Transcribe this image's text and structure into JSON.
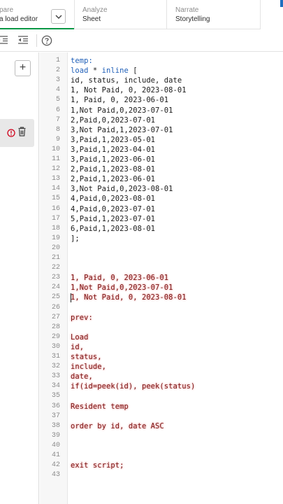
{
  "tabs": {
    "prepare": {
      "caption": "pare",
      "title": "a load editor"
    },
    "analyze": {
      "caption": "Analyze",
      "title": "Sheet"
    },
    "narrate": {
      "caption": "Narrate",
      "title": "Storytelling"
    }
  },
  "toolbar": {
    "icons": [
      "indent-icon",
      "outdent-icon",
      "help-icon"
    ]
  },
  "left_panel": {
    "add_label": "+"
  },
  "editor": {
    "line_numbers": [
      "1",
      "2",
      "3",
      "4",
      "5",
      "6",
      "7",
      "8",
      "9",
      "10",
      "11",
      "12",
      "13",
      "14",
      "15",
      "16",
      "17",
      "18",
      "19",
      "20",
      "21",
      "22",
      "23",
      "24",
      "25",
      "26",
      "27",
      "28",
      "29",
      "30",
      "31",
      "32",
      "33",
      "34",
      "35",
      "36",
      "37",
      "38",
      "39",
      "40",
      "41",
      "42",
      "43"
    ],
    "lines": [
      {
        "n": 1,
        "text": "temp:",
        "style": "kw"
      },
      {
        "n": 2,
        "text": "load * inline [",
        "style": "kw"
      },
      {
        "n": 3,
        "text": "id, status, include, date",
        "style": "plain"
      },
      {
        "n": 4,
        "text": "1, Not Paid, 0, 2023-08-01",
        "style": "plain"
      },
      {
        "n": 5,
        "text": "1, Paid, 0, 2023-06-01",
        "style": "plain"
      },
      {
        "n": 6,
        "text": "1,Not Paid,0,2023-07-01",
        "style": "plain"
      },
      {
        "n": 7,
        "text": "2,Paid,0,2023-07-01",
        "style": "plain"
      },
      {
        "n": 8,
        "text": "3,Not Paid,1,2023-07-01",
        "style": "plain"
      },
      {
        "n": 9,
        "text": "3,Paid,1,2023-05-01",
        "style": "plain"
      },
      {
        "n": 10,
        "text": "3,Paid,1,2023-04-01",
        "style": "plain"
      },
      {
        "n": 11,
        "text": "3,Paid,1,2023-06-01",
        "style": "plain"
      },
      {
        "n": 12,
        "text": "2,Paid,1,2023-08-01",
        "style": "plain"
      },
      {
        "n": 13,
        "text": "2,Paid,1,2023-06-01",
        "style": "plain"
      },
      {
        "n": 14,
        "text": "3,Not Paid,0,2023-08-01",
        "style": "plain"
      },
      {
        "n": 15,
        "text": "4,Paid,0,2023-08-01",
        "style": "plain"
      },
      {
        "n": 16,
        "text": "4,Paid,0,2023-07-01",
        "style": "plain"
      },
      {
        "n": 17,
        "text": "5,Paid,1,2023-07-01",
        "style": "plain"
      },
      {
        "n": 18,
        "text": "6,Paid,1,2023-08-01",
        "style": "plain"
      },
      {
        "n": 19,
        "text": "];",
        "style": "plain"
      },
      {
        "n": 20,
        "text": "",
        "style": "plain"
      },
      {
        "n": 21,
        "text": "",
        "style": "plain"
      },
      {
        "n": 22,
        "text": "",
        "style": "plain"
      },
      {
        "n": 23,
        "text": "1, Paid, 0, 2023-06-01",
        "style": "red"
      },
      {
        "n": 24,
        "text": "1,Not Paid,0,2023-07-01",
        "style": "red"
      },
      {
        "n": 25,
        "text": "1, Not Paid, 0, 2023-08-01",
        "style": "red"
      },
      {
        "n": 26,
        "text": "",
        "style": "plain"
      },
      {
        "n": 27,
        "text": "prev:",
        "style": "red"
      },
      {
        "n": 28,
        "text": "",
        "style": "plain"
      },
      {
        "n": 29,
        "text": "Load",
        "style": "red"
      },
      {
        "n": 30,
        "text": "id,",
        "style": "red"
      },
      {
        "n": 31,
        "text": "status,",
        "style": "red"
      },
      {
        "n": 32,
        "text": "include,",
        "style": "red"
      },
      {
        "n": 33,
        "text": "date,",
        "style": "red"
      },
      {
        "n": 34,
        "text": "if(id=peek(id), peek(status)",
        "style": "red"
      },
      {
        "n": 35,
        "text": "",
        "style": "plain"
      },
      {
        "n": 36,
        "text": "Resident temp",
        "style": "red"
      },
      {
        "n": 37,
        "text": "",
        "style": "plain"
      },
      {
        "n": 38,
        "text": "order by id, date ASC",
        "style": "red"
      },
      {
        "n": 39,
        "text": "",
        "style": "plain"
      },
      {
        "n": 40,
        "text": "",
        "style": "plain"
      },
      {
        "n": 41,
        "text": "",
        "style": "plain"
      },
      {
        "n": 42,
        "text": "exit script;",
        "style": "red"
      },
      {
        "n": 43,
        "text": "",
        "style": "plain"
      }
    ],
    "cursor_line": 25
  }
}
